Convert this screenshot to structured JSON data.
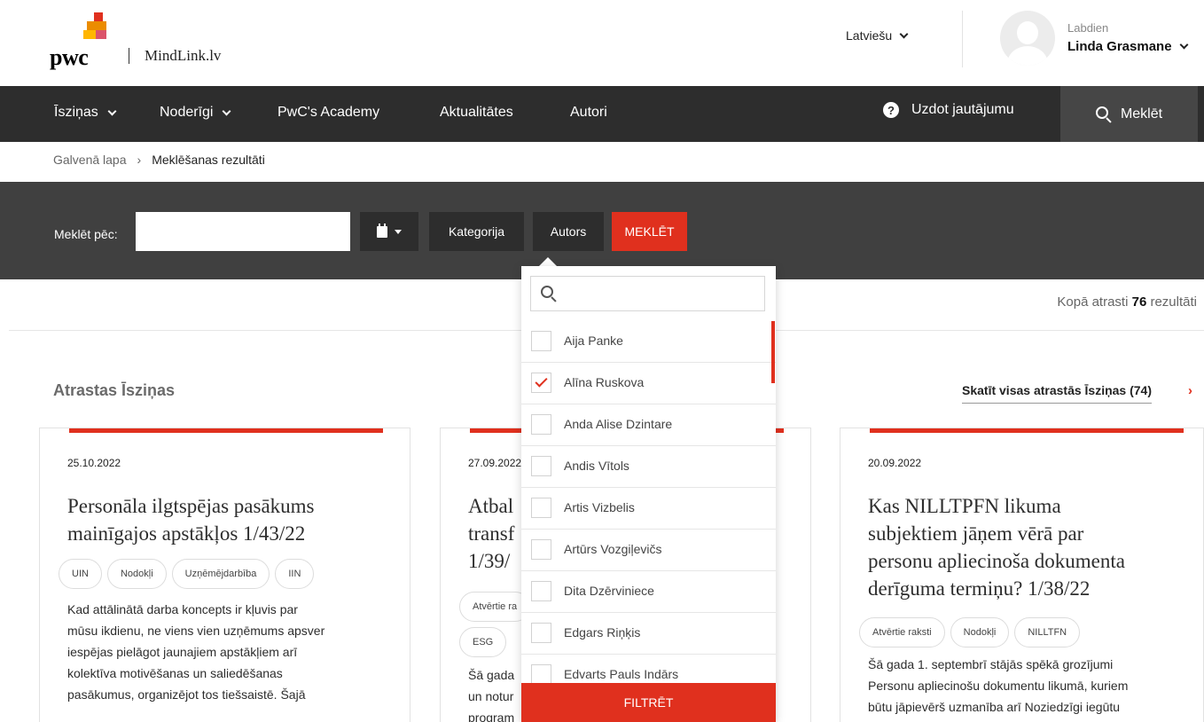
{
  "header": {
    "logo_text": "pwc",
    "site_name": "MindLink.lv",
    "language": "Latviešu",
    "greeting": "Labdien",
    "user_name": "Linda Grasmane"
  },
  "nav": {
    "items": [
      "Īsziņas",
      "Noderīgi",
      "PwC's Academy",
      "Aktualitātes",
      "Autori"
    ],
    "ask": "Uzdot jautājumu",
    "search": "Meklēt"
  },
  "breadcrumb": {
    "home": "Galvenā lapa",
    "separator": "›",
    "current": "Meklēšanas rezultāti"
  },
  "search_band": {
    "label": "Meklēt pēc:",
    "query": "",
    "category": "Kategorija",
    "author": "Autors",
    "submit": "MEKLĒT"
  },
  "results": {
    "prefix": "Kopā atrasti",
    "count": "76",
    "suffix": "rezultāti"
  },
  "section": {
    "title": "Atrastas Īsziņas",
    "see_all": "Skatīt visas atrastās Īsziņas (74)",
    "arrow": "›"
  },
  "cards": [
    {
      "date": "25.10.2022",
      "title_lines": [
        "Personāla ilgtspējas pasākums",
        "mainīgajos apstākļos 1/43/22"
      ],
      "tags": [
        "UIN",
        "Nodokļi",
        "Uzņēmējdarbība",
        "IIN"
      ],
      "excerpt_lines": [
        "Kad attālinātā darba koncepts ir kļuvis par",
        "mūsu ikdienu, ne viens vien uzņēmums apsver",
        "iespējas pielāgot jaunajiem apstākļiem arī",
        "kolektīva motivēšanas un saliedēšanas",
        "pasākumus, organizējot tos tiešsaistē. Šajā"
      ]
    },
    {
      "date": "27.09.2022",
      "title_lines": [
        "Atbal",
        "transf",
        "1/39/"
      ],
      "tags": [
        "Atvērtie ra",
        "ESG"
      ],
      "excerpt_lines": [
        "Šā gada",
        "un notur",
        "program"
      ]
    },
    {
      "date": "20.09.2022",
      "title_lines": [
        "Kas NILLTPFN likuma",
        "subjektiem jāņem vērā par",
        "personu apliecinoša dokumenta",
        "derīguma termiņu? 1/38/22"
      ],
      "tags": [
        "Atvērtie raksti",
        "Nodokļi",
        "NILLTFN"
      ],
      "excerpt_lines": [
        "Šā gada 1. septembrī stājās spēkā grozījumi",
        "Personu apliecinošu dokumentu likumā, kuriem",
        "būtu jāpievērš uzmanība arī Noziedzīgi iegūtu"
      ]
    }
  ],
  "author_dropdown": {
    "search_placeholder": "",
    "authors": [
      {
        "name": "Aija Panke",
        "checked": false
      },
      {
        "name": "Alīna Ruskova",
        "checked": true
      },
      {
        "name": "Anda Alise Dzintare",
        "checked": false
      },
      {
        "name": "Andis Vītols",
        "checked": false
      },
      {
        "name": "Artis Vizbelis",
        "checked": false
      },
      {
        "name": "Artūrs Vozgiļevičs",
        "checked": false
      },
      {
        "name": "Dita Dzērviniece",
        "checked": false
      },
      {
        "name": "Edgars Riņķis",
        "checked": false
      },
      {
        "name": "Edvarts Pauls Indārs",
        "checked": false
      }
    ],
    "filter_button": "FILTRĒT"
  },
  "colors": {
    "accent": "#e0301e",
    "nav_bg": "#2d2d2d",
    "band_bg": "#404040"
  }
}
